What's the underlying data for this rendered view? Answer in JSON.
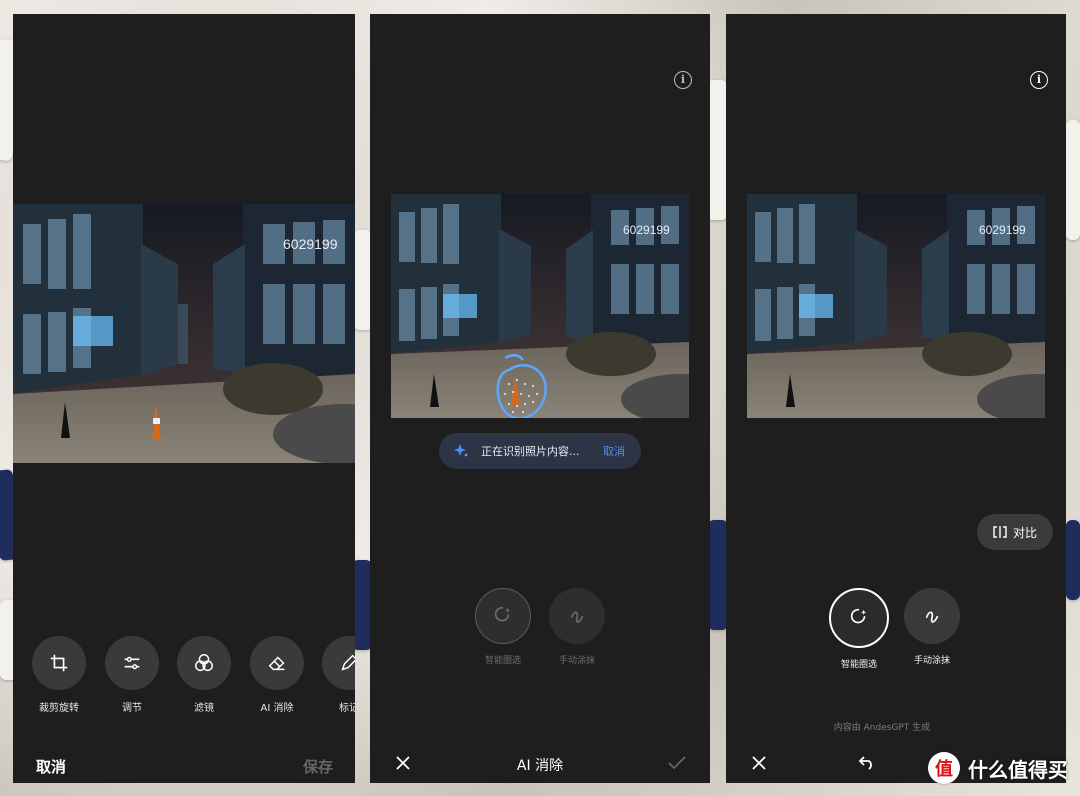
{
  "panel1": {
    "tools": [
      {
        "label": "裁剪旋转",
        "icon": "crop-rotate-icon"
      },
      {
        "label": "调节",
        "icon": "sliders-icon"
      },
      {
        "label": "滤镜",
        "icon": "filter-circles-icon"
      },
      {
        "label": "AI 消除",
        "icon": "eraser-icon"
      },
      {
        "label": "标记",
        "icon": "pen-icon"
      }
    ],
    "cancel_label": "取消",
    "save_label": "保存"
  },
  "panel2": {
    "title": "AI 消除",
    "status_message": "正在识别照片内容...",
    "status_cancel": "取消",
    "tools": [
      {
        "label": "智能圈选",
        "icon": "lasso-sparkle-icon"
      },
      {
        "label": "手动涂抹",
        "icon": "scribble-icon"
      }
    ]
  },
  "panel3": {
    "compare_label": "对比",
    "tools": [
      {
        "label": "智能圈选",
        "icon": "lasso-sparkle-icon"
      },
      {
        "label": "手动涂抹",
        "icon": "scribble-icon"
      }
    ],
    "credit": "内容由 AndesGPT 生成"
  },
  "watermark": {
    "badge": "值",
    "text": "什么值得买"
  },
  "colors": {
    "accent_blue": "#4a8dff",
    "panel_bg": "#1e1e1e",
    "tool_bg": "#3a3a3a"
  }
}
